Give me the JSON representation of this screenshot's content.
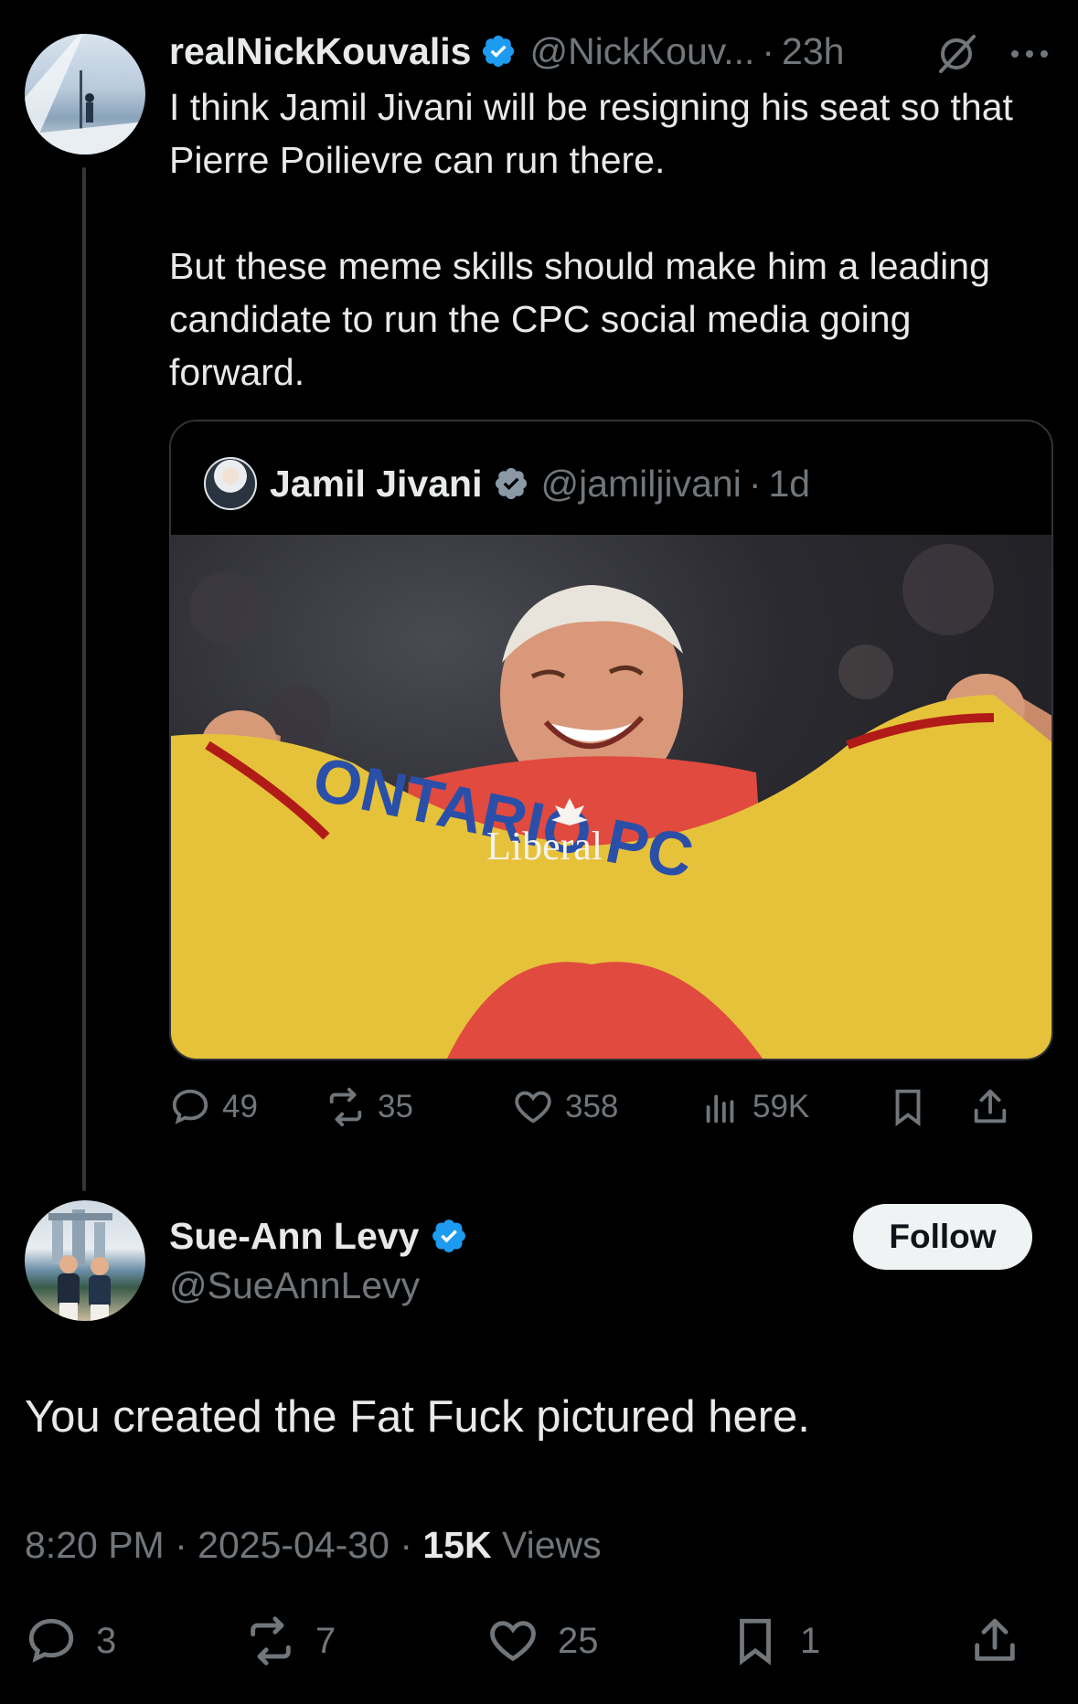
{
  "colors": {
    "background": "#000000",
    "text_primary": "#e7e9ea",
    "text_muted": "#71767b",
    "verified_blue": "#1d9bf0",
    "border": "#2f3336",
    "follow_bg": "#eff3f4"
  },
  "parent": {
    "display_name": "realNickKouvalis",
    "verified_icon": "verified-badge-icon",
    "handle": "@NickKouv...",
    "sep": "·",
    "time": "23h",
    "text_p1": "I think Jamil Jivani will be resigning his seat so that Pierre Poilievre can run there.",
    "text_p2": "But these meme skills should make him a leading candidate to run the CPC social media going forward.",
    "quote": {
      "display_name": "Jamil Jivani",
      "handle": "@jamiljivani",
      "sep": "·",
      "time": "1d",
      "image_text_1": "ONTARIO PC",
      "image_text_2": "Liberal"
    },
    "actions": {
      "replies": "49",
      "reposts": "35",
      "likes": "358",
      "views": "59K"
    }
  },
  "reply": {
    "display_name": "Sue-Ann Levy",
    "handle": "@SueAnnLevy",
    "follow_label": "Follow",
    "text": "You created the Fat Fuck pictured here.",
    "time": "8:20 PM",
    "sep1": "·",
    "date": "2025-04-30",
    "sep2": "·",
    "views_count": "15K",
    "views_label": "Views",
    "actions": {
      "replies": "3",
      "reposts": "7",
      "likes": "25",
      "bookmarks": "1"
    }
  }
}
